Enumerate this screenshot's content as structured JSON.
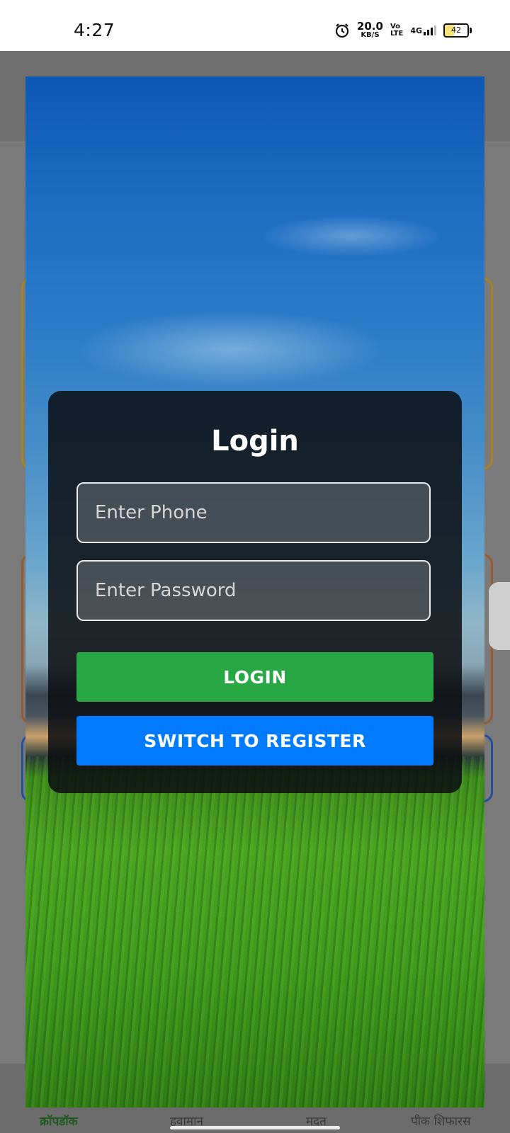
{
  "status_bar": {
    "time": "4:27",
    "net_speed_value": "20.0",
    "net_speed_unit": "KB/S",
    "volte_top": "Vo",
    "volte_bottom": "LTE",
    "network_type": "4G",
    "battery_level": "42",
    "icons": [
      "alarm-icon",
      "signal-icon",
      "battery-icon"
    ]
  },
  "login": {
    "title": "Login",
    "phone_placeholder": "Enter Phone",
    "password_placeholder": "Enter Password",
    "login_button": "LOGIN",
    "register_button": "SWITCH TO REGISTER"
  },
  "bottom_nav": {
    "items": [
      {
        "label": "क्रॉपडॉक",
        "active": true
      },
      {
        "label": "हवामान",
        "active": false
      },
      {
        "label": "मदत",
        "active": false
      },
      {
        "label": "पीक शिफारस",
        "active": false
      }
    ]
  },
  "colors": {
    "login_button": "#28a745",
    "register_button": "#007bff",
    "card_background": "#0c0e12",
    "nav_active": "#1e5a1e"
  }
}
